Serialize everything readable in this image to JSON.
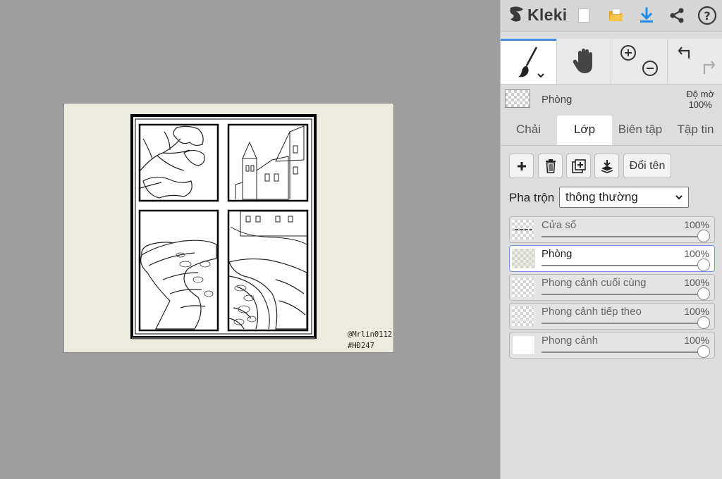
{
  "app": {
    "name": "Kleki"
  },
  "canvas": {
    "signature_line1": "@Mrlin0112",
    "signature_line2": "#HĐ247"
  },
  "toolbar": {
    "icons": [
      "new-image-icon",
      "open-folder-icon",
      "download-icon",
      "share-icon",
      "help-icon"
    ],
    "accent": "#1e8ce6",
    "folder_color": "#f0b428"
  },
  "tools": {
    "brush": "brush-icon",
    "hand": "hand-icon",
    "zoom_in": "zoom-in-icon",
    "zoom_out": "zoom-out-icon",
    "undo": "undo-icon",
    "redo": "redo-icon"
  },
  "current_layer": {
    "name": "Phòng",
    "opacity_label": "Độ mờ",
    "opacity_value": "100%"
  },
  "tabs": [
    {
      "label": "Chải",
      "active": false
    },
    {
      "label": "Lớp",
      "active": true
    },
    {
      "label": "Biên tập",
      "active": false
    },
    {
      "label": "Tập tin",
      "active": false
    }
  ],
  "layer_actions": {
    "rename_label": "Đổi tên"
  },
  "blend": {
    "label": "Pha trộn",
    "selected": "thông thường"
  },
  "layers": [
    {
      "name": "Cửa sổ",
      "opacity": "100%",
      "opacity_fraction": 1.0,
      "selected": false
    },
    {
      "name": "Phòng",
      "opacity": "100%",
      "opacity_fraction": 1.0,
      "selected": true
    },
    {
      "name": "Phong cảnh cuối cùng",
      "opacity": "100%",
      "opacity_fraction": 1.0,
      "selected": false
    },
    {
      "name": "Phong cảnh tiếp theo",
      "opacity": "100%",
      "opacity_fraction": 1.0,
      "selected": false
    },
    {
      "name": "Phong cảnh",
      "opacity": "100%",
      "opacity_fraction": 1.0,
      "selected": false
    }
  ]
}
